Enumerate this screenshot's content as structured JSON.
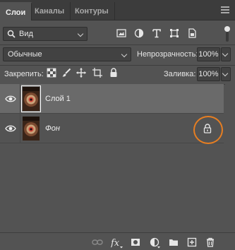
{
  "tabs": [
    {
      "label": "Слои",
      "active": true
    },
    {
      "label": "Каналы",
      "active": false
    },
    {
      "label": "Контуры",
      "active": false
    }
  ],
  "filter": {
    "kind_label": "Вид",
    "icons": [
      "image-filter-icon",
      "adjustment-filter-icon",
      "type-filter-icon",
      "shape-filter-icon",
      "smart-object-filter-icon"
    ]
  },
  "blend": {
    "mode": "Обычные",
    "opacity_label": "Непрозрачность:",
    "opacity_value": "100%"
  },
  "lock": {
    "label": "Закрепить:",
    "icons": [
      "lock-transparent-pixels-icon",
      "lock-image-pixels-icon",
      "lock-position-icon",
      "lock-artboard-icon",
      "lock-all-icon"
    ],
    "fill_label": "Заливка:",
    "fill_value": "100%"
  },
  "layers": [
    {
      "name": "Слой 1",
      "visible": true,
      "selected": true,
      "locked": false
    },
    {
      "name": "Фон",
      "visible": true,
      "selected": false,
      "locked": true
    }
  ],
  "footer_icons": [
    "link-layers-icon",
    "fx-icon",
    "layer-mask-icon",
    "adjustment-layer-icon",
    "group-folder-icon",
    "new-layer-icon",
    "trash-icon"
  ],
  "colors": {
    "panel_bg": "#535353",
    "selected_layer": "#6a6a6a",
    "highlight_ring": "#e67e22"
  }
}
